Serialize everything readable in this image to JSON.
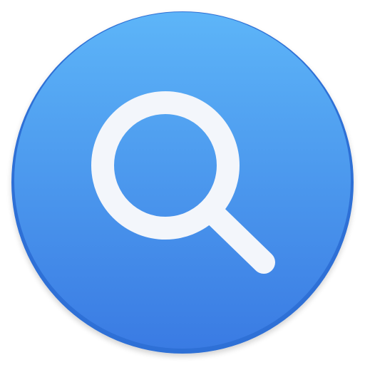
{
  "app_icon": {
    "icon": "magnifying-glass-icon",
    "colors": {
      "page_background": "#ffffff",
      "circle_top": "#5db5f8",
      "circle_bottom": "#3a7be3",
      "circle_edge": "#2f6fd6",
      "glyph": "#f3f6fb"
    }
  }
}
